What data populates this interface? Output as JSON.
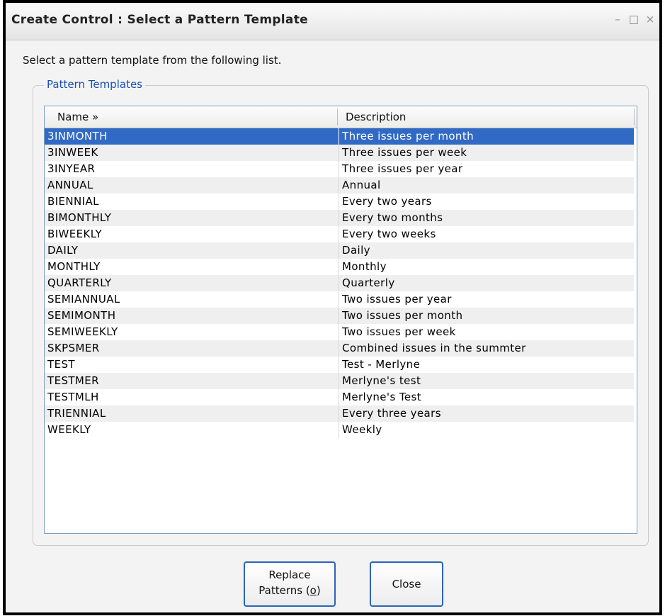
{
  "window": {
    "title": "Create Control : Select a Pattern Template",
    "controls": {
      "minimize": "–",
      "maximize": "□",
      "close": "×"
    }
  },
  "prompt": "Select a pattern template from the following list.",
  "group": {
    "legend": "Pattern Templates"
  },
  "table": {
    "columns": [
      "Name »",
      "Description"
    ],
    "selected_index": 0,
    "rows": [
      {
        "name": "3INMONTH",
        "description": "Three issues per month"
      },
      {
        "name": "3INWEEK",
        "description": "Three issues per week"
      },
      {
        "name": "3INYEAR",
        "description": "Three issues per year"
      },
      {
        "name": "ANNUAL",
        "description": "Annual"
      },
      {
        "name": "BIENNIAL",
        "description": "Every two years"
      },
      {
        "name": "BIMONTHLY",
        "description": "Every two months"
      },
      {
        "name": "BIWEEKLY",
        "description": "Every two weeks"
      },
      {
        "name": "DAILY",
        "description": "Daily"
      },
      {
        "name": "MONTHLY",
        "description": "Monthly"
      },
      {
        "name": "QUARTERLY",
        "description": "Quarterly"
      },
      {
        "name": "SEMIANNUAL",
        "description": "Two issues per year"
      },
      {
        "name": "SEMIMONTH",
        "description": "Two issues per month"
      },
      {
        "name": "SEMIWEEKLY",
        "description": "Two issues per week"
      },
      {
        "name": "SKPSMER",
        "description": "Combined issues in the summter"
      },
      {
        "name": "TEST",
        "description": "Test - Merlyne"
      },
      {
        "name": "TESTMER",
        "description": "Merlyne's test"
      },
      {
        "name": "TESTMLH",
        "description": "Merlyne's Test"
      },
      {
        "name": "TRIENNIAL",
        "description": "Every three years"
      },
      {
        "name": "WEEKLY",
        "description": "Weekly"
      }
    ]
  },
  "buttons": {
    "replace_line1": "Replace",
    "replace_line2_prefix": "Patterns (",
    "replace_accel": "o",
    "replace_line2_suffix": ")",
    "close": "Close"
  },
  "colors": {
    "selection": "#316ac5",
    "legend_text": "#1b4fb5",
    "button_border": "#2d64b8"
  }
}
